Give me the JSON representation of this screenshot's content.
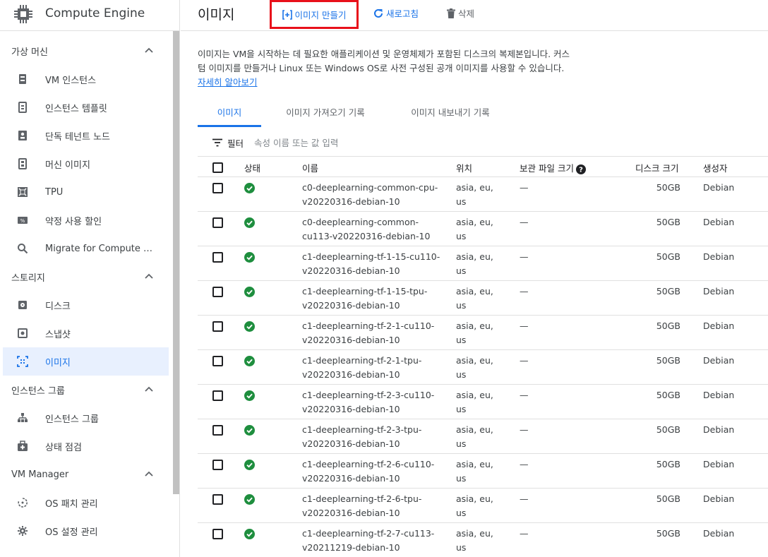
{
  "app": {
    "title": "Compute Engine"
  },
  "sidebar": {
    "sections": [
      {
        "label": "가상 머신",
        "items": [
          {
            "label": "VM 인스턴스",
            "icon": "vm-instance-icon"
          },
          {
            "label": "인스턴스 템플릿",
            "icon": "instance-template-icon"
          },
          {
            "label": "단독 테넌트 노드",
            "icon": "sole-tenant-node-icon"
          },
          {
            "label": "머신 이미지",
            "icon": "machine-image-icon"
          },
          {
            "label": "TPU",
            "icon": "tpu-icon"
          },
          {
            "label": "약정 사용 할인",
            "icon": "committed-use-discount-icon"
          },
          {
            "label": "Migrate for Compute Engi...",
            "icon": "search-icon"
          }
        ]
      },
      {
        "label": "스토리지",
        "items": [
          {
            "label": "디스크",
            "icon": "disk-icon"
          },
          {
            "label": "스냅샷",
            "icon": "snapshot-icon"
          },
          {
            "label": "이미지",
            "icon": "image-icon",
            "active": true
          }
        ]
      },
      {
        "label": "인스턴스 그룹",
        "items": [
          {
            "label": "인스턴스 그룹",
            "icon": "instance-group-icon"
          },
          {
            "label": "상태 점검",
            "icon": "health-check-icon"
          }
        ]
      },
      {
        "label": "VM Manager",
        "items": [
          {
            "label": "OS 패치 관리",
            "icon": "os-patch-icon"
          },
          {
            "label": "OS 설정 관리",
            "icon": "os-config-icon"
          }
        ]
      }
    ]
  },
  "header": {
    "title": "이미지",
    "create_label": "이미지 만들기",
    "refresh_label": "새로고침",
    "delete_label": "삭제"
  },
  "description": {
    "text": "이미지는 VM을 시작하는 데 필요한 애플리케이션 및 운영체제가 포함된 디스크의 복제본입니다. 커스텀 이미지를 만들거나 Linux 또는 Windows OS로 사전 구성된 공개 이미지를 사용할 수 있습니다. ",
    "link": "자세히 알아보기"
  },
  "tabs": [
    {
      "label": "이미지",
      "active": true
    },
    {
      "label": "이미지 가져오기 기록"
    },
    {
      "label": "이미지 내보내기 기록"
    }
  ],
  "filter": {
    "label": "필터",
    "placeholder": "속성 이름 또는 값 입력"
  },
  "table": {
    "headers": {
      "status": "상태",
      "name": "이름",
      "location": "위치",
      "archive_size": "보관 파일 크기",
      "disk_size": "디스크 크기",
      "creator": "생성자"
    },
    "rows": [
      {
        "name": "c0-deeplearning-common-cpu-v20220316-debian-10",
        "location": "asia, eu, us",
        "archive": "—",
        "size": "50GB",
        "creator": "Debian"
      },
      {
        "name": "c0-deeplearning-common-cu113-v20220316-debian-10",
        "location": "asia, eu, us",
        "archive": "—",
        "size": "50GB",
        "creator": "Debian"
      },
      {
        "name": "c1-deeplearning-tf-1-15-cu110-v20220316-debian-10",
        "location": "asia, eu, us",
        "archive": "—",
        "size": "50GB",
        "creator": "Debian"
      },
      {
        "name": "c1-deeplearning-tf-1-15-tpu-v20220316-debian-10",
        "location": "asia, eu, us",
        "archive": "—",
        "size": "50GB",
        "creator": "Debian"
      },
      {
        "name": "c1-deeplearning-tf-2-1-cu110-v20220316-debian-10",
        "location": "asia, eu, us",
        "archive": "—",
        "size": "50GB",
        "creator": "Debian"
      },
      {
        "name": "c1-deeplearning-tf-2-1-tpu-v20220316-debian-10",
        "location": "asia, eu, us",
        "archive": "—",
        "size": "50GB",
        "creator": "Debian"
      },
      {
        "name": "c1-deeplearning-tf-2-3-cu110-v20220316-debian-10",
        "location": "asia, eu, us",
        "archive": "—",
        "size": "50GB",
        "creator": "Debian"
      },
      {
        "name": "c1-deeplearning-tf-2-3-tpu-v20220316-debian-10",
        "location": "asia, eu, us",
        "archive": "—",
        "size": "50GB",
        "creator": "Debian"
      },
      {
        "name": "c1-deeplearning-tf-2-6-cu110-v20220316-debian-10",
        "location": "asia, eu, us",
        "archive": "—",
        "size": "50GB",
        "creator": "Debian"
      },
      {
        "name": "c1-deeplearning-tf-2-6-tpu-v20220316-debian-10",
        "location": "asia, eu, us",
        "archive": "—",
        "size": "50GB",
        "creator": "Debian"
      },
      {
        "name": "c1-deeplearning-tf-2-7-cu113-v20211219-debian-10",
        "location": "asia, eu, us",
        "archive": "—",
        "size": "50GB",
        "creator": "Debian"
      }
    ]
  },
  "colors": {
    "accent": "#1a73e8",
    "status_ok": "#1e8e3e",
    "highlight_border": "#e8101a"
  }
}
